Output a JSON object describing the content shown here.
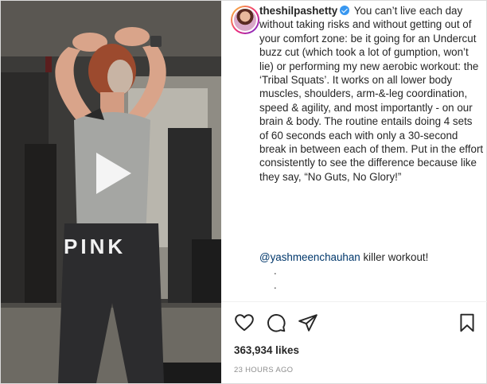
{
  "post": {
    "media": {
      "shirt_text": "PINK",
      "play_icon": "play-icon"
    },
    "author": {
      "username": "theshilpashetty",
      "verified_icon": "verified-badge-icon",
      "avatar_icon": "avatar"
    },
    "caption": "You can’t live each day without taking risks and without getting out of your comfort zone: be it going for an Undercut buzz cut (which took a lot of gumption, won’t lie) or performing my new aerobic workout: the ‘Tribal Squats’. It works on all lower body muscles, shoulders, arm-&-leg coordination, speed & agility, and most importantly - on our brain & body. The routine entails doing 4 sets of 60 seconds each with only a 30-second break in between each of them. Put in the effort consistently to see the difference because like they say, “No Guts, No Glory!”",
    "mention": "@yashmeenchauhan",
    "mention_suffix": " killer workout!",
    "dots": [
      ".",
      "."
    ],
    "actions": {
      "like_icon": "heart-icon",
      "comment_icon": "comment-icon",
      "share_icon": "share-icon",
      "save_icon": "bookmark-icon"
    },
    "likes": "363,934 likes",
    "timestamp": "23 HOURS AGO"
  },
  "colors": {
    "link": "#00376b",
    "verified": "#3897f0",
    "text": "#262626",
    "muted": "#8e8e8e"
  }
}
